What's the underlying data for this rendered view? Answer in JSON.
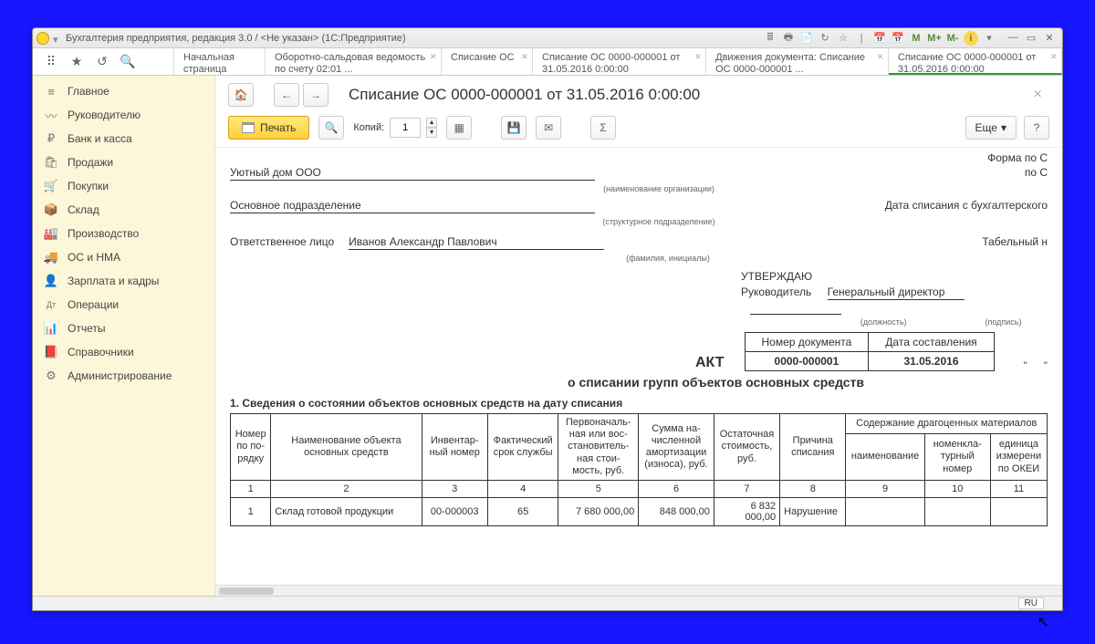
{
  "titlebar": {
    "title": "Бухгалтерия предприятия, редакция 3.0 / <Не указан>  (1С:Предприятие)"
  },
  "tabs": [
    {
      "label": "Начальная страница",
      "close": false
    },
    {
      "label": "Оборотно-сальдовая ведомость по счету 02:01 ...",
      "close": true
    },
    {
      "label": "Списание ОС",
      "close": true
    },
    {
      "label": "Списание ОС 0000-000001 от 31.05.2016 0:00:00",
      "close": true
    },
    {
      "label": "Движения документа: Списание ОС 0000-000001 ...",
      "close": true
    },
    {
      "label": "Списание ОС 0000-000001 от 31.05.2016 0:00:00",
      "close": true,
      "active": true
    }
  ],
  "sidebar": [
    {
      "icon": "≡",
      "label": "Главное"
    },
    {
      "icon": "〰",
      "label": "Руководителю"
    },
    {
      "icon": "₽",
      "label": "Банк и касса"
    },
    {
      "icon": "🛍",
      "label": "Продажи"
    },
    {
      "icon": "🛒",
      "label": "Покупки"
    },
    {
      "icon": "📦",
      "label": "Склад"
    },
    {
      "icon": "🏭",
      "label": "Производство"
    },
    {
      "icon": "🚚",
      "label": "ОС и НМА"
    },
    {
      "icon": "👤",
      "label": "Зарплата и кадры"
    },
    {
      "icon": "Дт",
      "label": "Операции"
    },
    {
      "icon": "📊",
      "label": "Отчеты"
    },
    {
      "icon": "📕",
      "label": "Справочники"
    },
    {
      "icon": "⚙",
      "label": "Администрирование"
    }
  ],
  "doc": {
    "title": "Списание ОС 0000-000001 от 31.05.2016 0:00:00",
    "print_label": "Печать",
    "copies_label": "Копий:",
    "copies_value": "1",
    "more_label": "Еще",
    "help": "?"
  },
  "form": {
    "form_po": "Форма по С",
    "po_o": "по С",
    "org": "Уютный дом ООО",
    "org_hint": "(наименование организации)",
    "dept": "Основное подразделение",
    "dept_hint": "(структурное подразделение)",
    "date_label": "Дата списания с бухгалтерского",
    "resp_label": "Ответственное лицо",
    "resp_name": "Иванов Александр Павлович",
    "resp_hint": "(фамилия, инициалы)",
    "tabel": "Табельный н",
    "approve": "УТВЕРЖДАЮ",
    "rukovod": "Руководитель",
    "director": "Генеральный директор",
    "dolzhnost_hint": "(должность)",
    "podpis_hint": "(подпись)",
    "akt": "АКТ",
    "akt_table": {
      "h1": "Номер документа",
      "h2": "Дата составления",
      "v1": "0000-000001",
      "v2": "31.05.2016"
    },
    "akt_subtitle": "о списании групп объектов основных средств",
    "section1": "1. Сведения о состоянии объектов основных средств на дату списания",
    "col_span": "Содержание драгоценных материалов",
    "cols": [
      "Номер по по-рядку",
      "Наименование объекта основных средств",
      "Инвентар-ный номер",
      "Фактический срок службы",
      "Первоначаль-ная или вос-становитель-ная стои-мость, руб.",
      "Сумма на-численной амортизации (износа), руб.",
      "Остаточная стоимость, руб.",
      "Причина списания",
      "наименование",
      "номенкла-турный номер",
      "единица измерени по ОКЕИ"
    ],
    "nums": [
      "1",
      "2",
      "3",
      "4",
      "5",
      "6",
      "7",
      "8",
      "9",
      "10",
      "11"
    ],
    "row1": [
      "1",
      "Склад готовой продукции",
      "00-000003",
      "65",
      "7 680 000,00",
      "848 000,00",
      "6 832 000,00",
      "Нарушение",
      "",
      "",
      ""
    ]
  },
  "status": {
    "lang": "RU"
  }
}
